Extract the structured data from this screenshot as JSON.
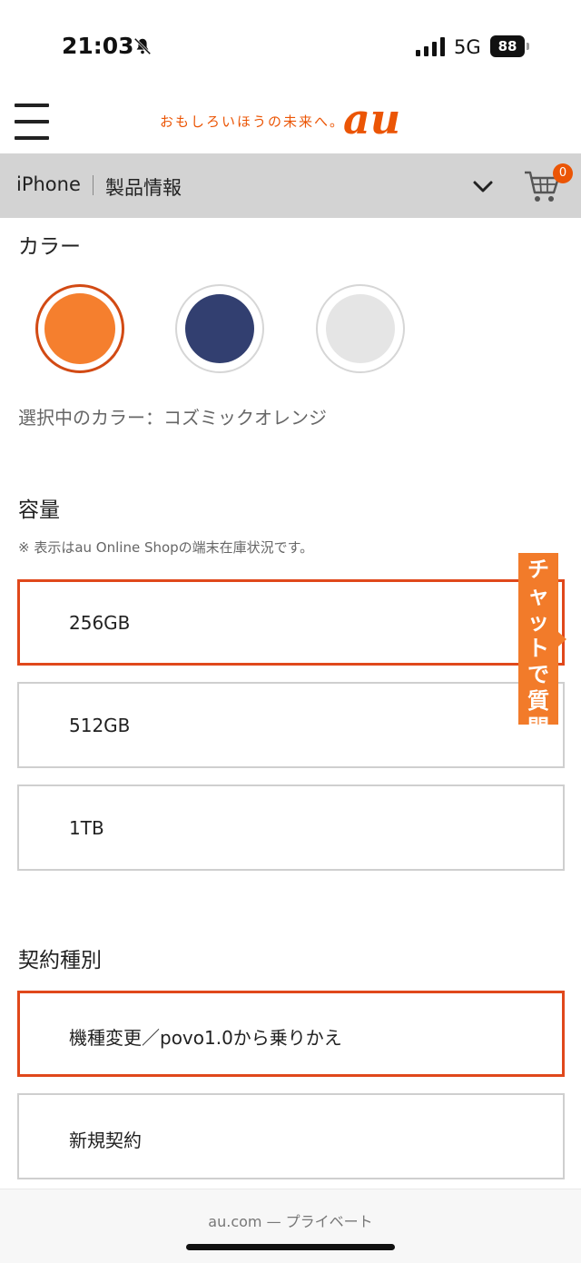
{
  "status_bar": {
    "time": "21:03",
    "network": "5G",
    "battery": "88"
  },
  "header": {
    "tagline": "おもしろいほうの未来へ。",
    "logo": "au",
    "menu_icon": "hamburger-menu-icon"
  },
  "subnav": {
    "product": "iPhone",
    "section": "製品情報",
    "cart_count": "0"
  },
  "color_section": {
    "heading": "カラー",
    "swatches": [
      {
        "name": "cosmic-orange",
        "color": "#f57f2e",
        "selected": true
      },
      {
        "name": "navy",
        "color": "#323f70",
        "selected": false
      },
      {
        "name": "silver",
        "color": "#e5e5e5",
        "selected": false
      }
    ],
    "selected_label": "選択中のカラー：コズミックオレンジ"
  },
  "capacity_section": {
    "heading": "容量",
    "note": "※ 表示はau Online Shopの端末在庫状況です。",
    "options": [
      {
        "label": "256GB",
        "selected": true
      },
      {
        "label": "512GB",
        "selected": false
      },
      {
        "label": "1TB",
        "selected": false
      }
    ]
  },
  "contract_section": {
    "heading": "契約種別",
    "options": [
      {
        "label": "機種変更／povo1.0から乗りかえ",
        "selected": true
      },
      {
        "label": "新規契約",
        "selected": false
      }
    ]
  },
  "chat": {
    "chars": [
      "チ",
      "ャ",
      "ッ",
      "ト",
      "で",
      "質",
      "問"
    ]
  },
  "browser": {
    "url": "au.com — プライベート"
  },
  "colors": {
    "accent": "#eb5505",
    "selected_border": "#e0481b",
    "nav_bg": "#d3d3d3"
  }
}
